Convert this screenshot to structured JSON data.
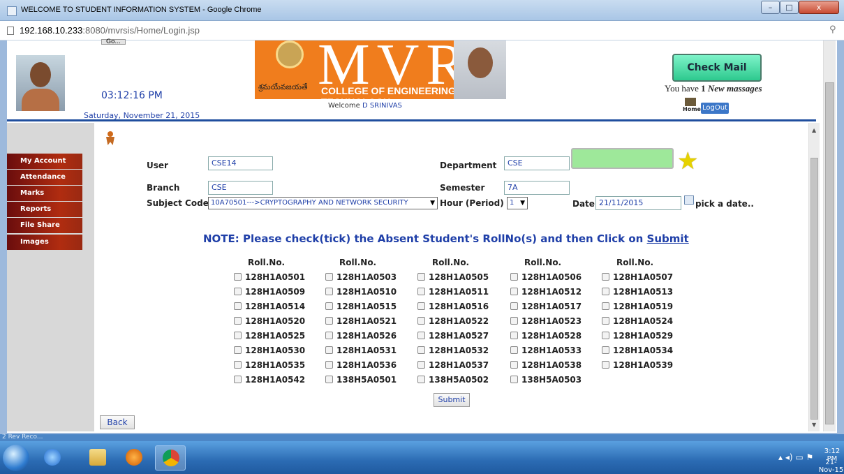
{
  "window": {
    "title": "WELCOME TO STUDENT INFORMATION SYSTEM - Google Chrome",
    "minimize": "–",
    "maximize": "□",
    "close": "x"
  },
  "address": {
    "host": "192.168.10.233",
    "path": ":8080/mvrsis/Home/Login.jsp"
  },
  "header": {
    "go_label": "Go...",
    "clock": "03:12:16 PM",
    "date": "Saturday, November 21, 2015",
    "banner_letters": "MVR",
    "banner_telugu": "శ్రమయేవజయతే",
    "college": "COLLEGE OF ENGINEERING & TECHNOLOGY",
    "welcome_prefix": "Welcome",
    "welcome_name": "D SRINIVAS",
    "check_mail": "Check Mail",
    "mail_prefix": "You have",
    "mail_count": "1",
    "mail_suffix": "New massages",
    "home_label": "Home",
    "logout": "LogOut"
  },
  "sidebar": {
    "items": [
      {
        "label": "My Account"
      },
      {
        "label": "Attendance"
      },
      {
        "label": "Marks"
      },
      {
        "label": "Reports"
      },
      {
        "label": "File Share"
      },
      {
        "label": "Images"
      }
    ]
  },
  "form": {
    "user_label": "User",
    "user_value": "CSE14",
    "department_label": "Department",
    "department_value": "CSE",
    "branch_label": "Branch",
    "branch_value": "CSE",
    "semester_label": "Semester",
    "semester_value": "7A",
    "subject_label": "Subject Code",
    "subject_value": "10A70501--->CRYPTOGRAPHY AND NETWORK SECURITY",
    "hour_label": "Hour (Period)",
    "hour_value": "1",
    "date_label": "Date",
    "date_value": "21/11/2015",
    "pick_date": "pick a date.."
  },
  "note": {
    "text": "NOTE: Please check(tick) the Absent Student's RollNo(s) and then Click on",
    "link": "Submit"
  },
  "attendance": {
    "column_header": "Roll.No.",
    "columns": [
      [
        "128H1A0501",
        "128H1A0509",
        "128H1A0514",
        "128H1A0520",
        "128H1A0525",
        "128H1A0530",
        "128H1A0535",
        "128H1A0542"
      ],
      [
        "128H1A0503",
        "128H1A0510",
        "128H1A0515",
        "128H1A0521",
        "128H1A0526",
        "128H1A0531",
        "128H1A0536",
        "138H5A0501"
      ],
      [
        "128H1A0505",
        "128H1A0511",
        "128H1A0516",
        "128H1A0522",
        "128H1A0527",
        "128H1A0532",
        "128H1A0537",
        "138H5A0502"
      ],
      [
        "128H1A0506",
        "128H1A0512",
        "128H1A0517",
        "128H1A0523",
        "128H1A0528",
        "128H1A0533",
        "128H1A0538",
        "138H5A0503"
      ],
      [
        "128H1A0507",
        "128H1A0513",
        "128H1A0519",
        "128H1A0524",
        "128H1A0529",
        "128H1A0534",
        "128H1A0539"
      ]
    ]
  },
  "buttons": {
    "submit": "Submit",
    "back": "Back"
  },
  "taskbar": {
    "strip_text": "2 Rev Reco...",
    "time": "3:12 PM",
    "date": "21-Nov-15"
  },
  "colors": {
    "accent_blue": "#1f3fa8",
    "nav_red": "#b02c10",
    "banner_orange": "#f07d1d",
    "mail_green": "#2dc98e"
  }
}
